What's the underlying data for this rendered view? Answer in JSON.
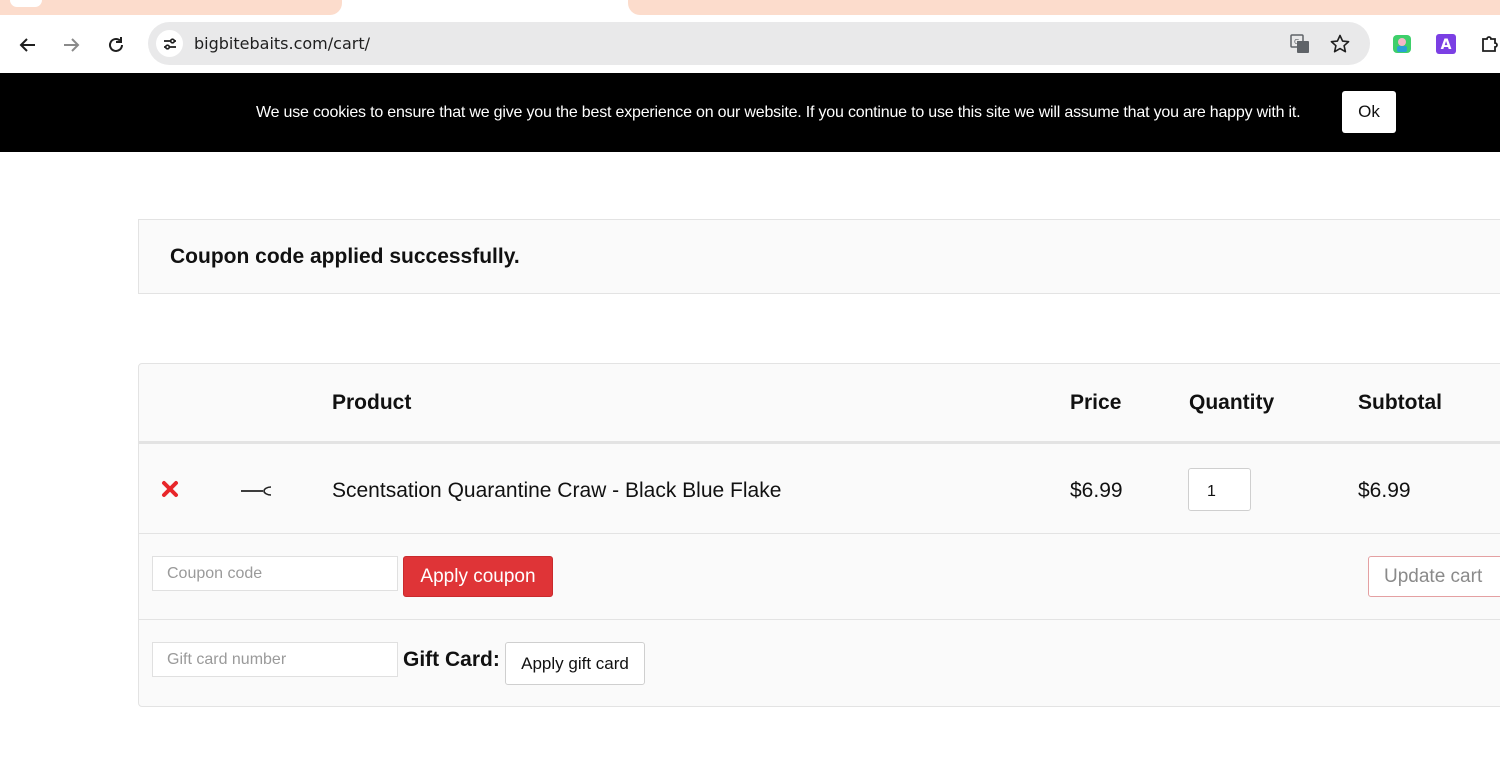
{
  "browser": {
    "url": "bigbitebaits.com/cart/",
    "icons": {
      "back": "arrow-left-icon",
      "forward": "arrow-right-icon",
      "reload": "reload-icon",
      "site_info": "tune-icon",
      "translate": "translate-icon",
      "bookmark": "star-icon",
      "ext1": "extension-green-icon",
      "ext2": "extension-a-icon",
      "ext3": "puzzle-icon"
    },
    "ext2_letter": "A"
  },
  "cookie_banner": {
    "text": "We use cookies to ensure that we give you the best experience on our website. If you continue to use this site we will assume that you are happy with it.",
    "ok_label": "Ok"
  },
  "notice": {
    "message": "Coupon code applied successfully."
  },
  "cart": {
    "headers": {
      "product": "Product",
      "price": "Price",
      "quantity": "Quantity",
      "subtotal": "Subtotal"
    },
    "items": [
      {
        "name": "Scentsation Quarantine Craw - Black Blue Flake",
        "price": "$6.99",
        "quantity": "1",
        "subtotal": "$6.99"
      }
    ],
    "coupon": {
      "placeholder": "Coupon code",
      "apply_label": "Apply coupon",
      "update_label": "Update cart"
    },
    "gift": {
      "placeholder": "Gift card number",
      "label": "Gift Card:",
      "apply_label": "Apply gift card"
    }
  },
  "colors": {
    "accent_red": "#df3437",
    "cookie_bg": "#000000",
    "tab_bg": "#fcdccc"
  }
}
